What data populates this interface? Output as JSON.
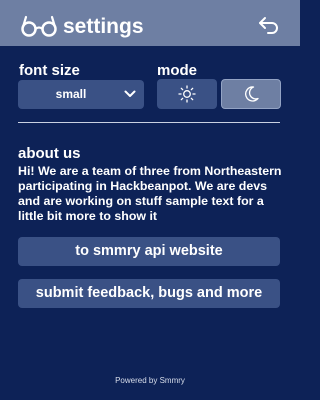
{
  "header": {
    "title": "settings",
    "logo_icon": "glasses-icon",
    "back_icon": "return-arrow-icon"
  },
  "font_size": {
    "label": "font size",
    "selected": "small",
    "dropdown_icon": "chevron-down-icon"
  },
  "mode": {
    "label": "mode",
    "options": [
      {
        "name": "light",
        "icon": "sun-icon",
        "active": false
      },
      {
        "name": "dark",
        "icon": "moon-icon",
        "active": true
      }
    ]
  },
  "about": {
    "title": "about us",
    "text": "Hi! We are a team of three from Northeastern participating in Hackbeanpot. We are devs and are working on stuff sample text for a little bit more to show it"
  },
  "buttons": {
    "website": "to smmry api website",
    "feedback": "submit feedback, bugs and more"
  },
  "footer": {
    "powered_by": "Powered by Smmry"
  },
  "colors": {
    "background": "#0d2257",
    "header": "#6e7fa3",
    "control": "#3a5185",
    "active_control": "#6e7fa3",
    "text": "#ffffff"
  }
}
